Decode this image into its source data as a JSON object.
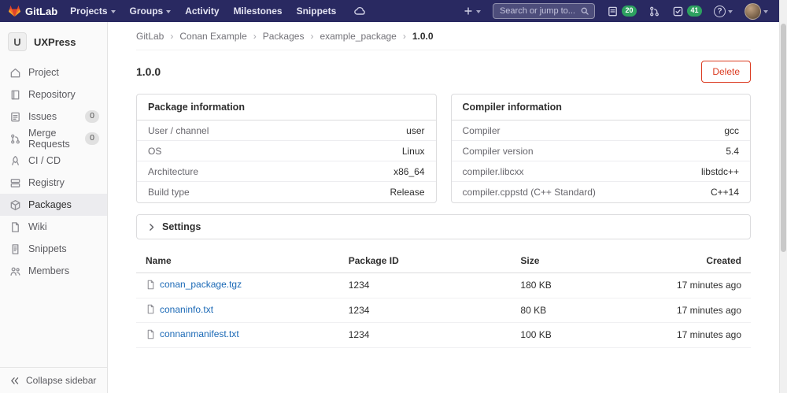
{
  "colors": {
    "navbar-bg": "#292961",
    "green": "#2da160",
    "danger": "#db3b21",
    "link": "#1b69b6"
  },
  "navbar": {
    "brand": "GitLab",
    "menu": [
      {
        "label": "Projects"
      },
      {
        "label": "Groups"
      },
      {
        "label": "Activity"
      },
      {
        "label": "Milestones"
      },
      {
        "label": "Snippets"
      }
    ],
    "search_placeholder": "Search or jump to...",
    "issues_count": "20",
    "todos_count": "41",
    "help_glyph": "?"
  },
  "sidebar": {
    "project_initial": "U",
    "project_name": "UXPress",
    "items": [
      {
        "label": "Project"
      },
      {
        "label": "Repository"
      },
      {
        "label": "Issues",
        "badge": "0"
      },
      {
        "label": "Merge Requests",
        "badge": "0"
      },
      {
        "label": "CI / CD"
      },
      {
        "label": "Registry"
      },
      {
        "label": "Packages"
      },
      {
        "label": "Wiki"
      },
      {
        "label": "Snippets"
      },
      {
        "label": "Members"
      }
    ],
    "collapse_label": "Collapse sidebar"
  },
  "breadcrumb": {
    "items": [
      "GitLab",
      "Conan Example",
      "Packages",
      "example_package",
      "1.0.0"
    ],
    "separator": "›"
  },
  "page": {
    "title": "1.0.0",
    "delete_label": "Delete"
  },
  "package_info": {
    "title": "Package information",
    "rows": [
      {
        "label": "User / channel",
        "value": "user"
      },
      {
        "label": "OS",
        "value": "Linux"
      },
      {
        "label": "Architecture",
        "value": "x86_64"
      },
      {
        "label": "Build type",
        "value": "Release"
      }
    ]
  },
  "compiler_info": {
    "title": "Compiler information",
    "rows": [
      {
        "label": "Compiler",
        "value": "gcc"
      },
      {
        "label": "Compiler version",
        "value": "5.4"
      },
      {
        "label": "compiler.libcxx",
        "value": "libstdc++"
      },
      {
        "label": "compiler.cppstd (C++ Standard)",
        "value": "C++14"
      }
    ]
  },
  "settings": {
    "label": "Settings"
  },
  "files_table": {
    "headers": [
      "Name",
      "Package ID",
      "Size",
      "Created"
    ],
    "rows": [
      {
        "name": "conan_package.tgz",
        "package_id": "1234",
        "size": "180 KB",
        "created": "17 minutes ago"
      },
      {
        "name": "conaninfo.txt",
        "package_id": "1234",
        "size": "80 KB",
        "created": "17 minutes ago"
      },
      {
        "name": "connanmanifest.txt",
        "package_id": "1234",
        "size": "100 KB",
        "created": "17 minutes ago"
      }
    ]
  }
}
